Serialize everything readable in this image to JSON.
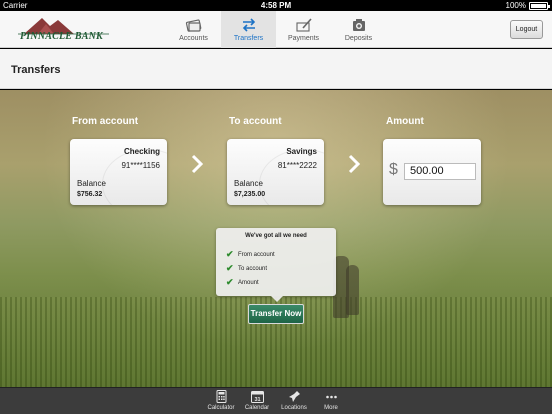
{
  "status_bar": {
    "carrier": "Carrier",
    "time": "4:58 PM",
    "battery": "100%",
    "battery_level": 1.0
  },
  "header": {
    "brand": "PINNACLE BANK",
    "tabs": [
      {
        "label": "Accounts",
        "icon": "wallet-icon",
        "active": false
      },
      {
        "label": "Transfers",
        "icon": "transfer-arrows-icon",
        "active": true
      },
      {
        "label": "Payments",
        "icon": "check-pen-icon",
        "active": false
      },
      {
        "label": "Deposits",
        "icon": "camera-icon",
        "active": false
      }
    ],
    "logout_label": "Logout"
  },
  "page": {
    "title": "Transfers"
  },
  "from_account": {
    "heading": "From account",
    "name": "Checking",
    "number": "91****1156",
    "balance_label": "Balance",
    "balance": "$756.32"
  },
  "to_account": {
    "heading": "To account",
    "name": "Savings",
    "number": "81****2222",
    "balance_label": "Balance",
    "balance": "$7,235.00"
  },
  "amount": {
    "heading": "Amount",
    "currency_symbol": "$",
    "value": "500.00"
  },
  "checklist": {
    "title": "We've got all we need",
    "items": [
      "From account",
      "To account",
      "Amount"
    ]
  },
  "transfer_button": "Transfer Now",
  "toolbar": {
    "items": [
      {
        "label": "Calculator",
        "icon": "calculator-icon"
      },
      {
        "label": "Calendar",
        "icon": "calendar-icon",
        "day": "31"
      },
      {
        "label": "Locations",
        "icon": "pin-icon"
      },
      {
        "label": "More",
        "icon": "more-dots-icon"
      }
    ]
  },
  "colors": {
    "accent": "#1d73c6",
    "brand_green": "#1f5a34",
    "button_green": "#2d7a59",
    "check_green": "#2e8b2e"
  }
}
